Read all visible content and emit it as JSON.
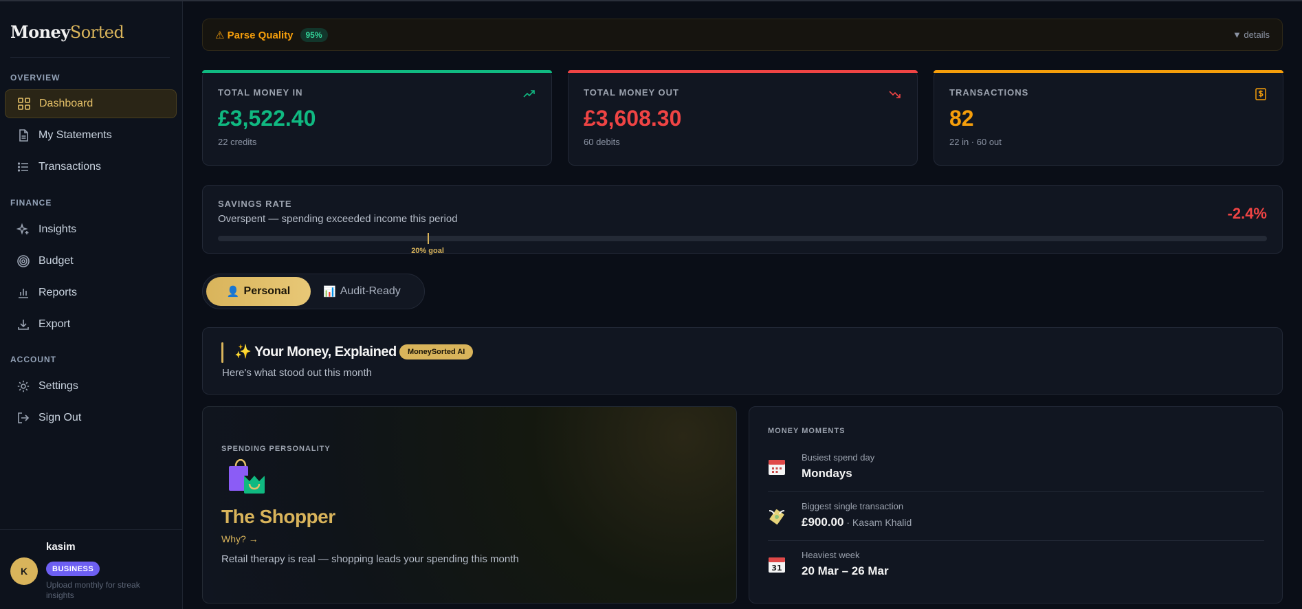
{
  "brand": {
    "part1": "Money",
    "part2": "Sorted"
  },
  "sidebar": {
    "sections": [
      {
        "label": "OVERVIEW"
      },
      {
        "label": "FINANCE"
      },
      {
        "label": "ACCOUNT"
      }
    ],
    "items": [
      {
        "label": "Dashboard",
        "icon": "grid-icon",
        "active": true
      },
      {
        "label": "My Statements",
        "icon": "file-icon"
      },
      {
        "label": "Transactions",
        "icon": "list-icon"
      },
      {
        "label": "Insights",
        "icon": "sparkle-icon"
      },
      {
        "label": "Budget",
        "icon": "target-icon"
      },
      {
        "label": "Reports",
        "icon": "bar-chart-icon"
      },
      {
        "label": "Export",
        "icon": "download-icon"
      },
      {
        "label": "Settings",
        "icon": "gear-icon"
      },
      {
        "label": "Sign Out",
        "icon": "logout-icon"
      }
    ]
  },
  "user": {
    "initial": "K",
    "name": "kasim",
    "plan": "BUSINESS",
    "note": "Upload monthly for streak insights"
  },
  "parse_quality": {
    "label": "⚠ Parse Quality",
    "value": "95%",
    "details": "▼ details"
  },
  "stats": [
    {
      "label": "TOTAL MONEY IN",
      "value": "£3,522.40",
      "sub": "22 credits",
      "color": "#10b981",
      "icon": "trend-up-icon"
    },
    {
      "label": "TOTAL MONEY OUT",
      "value": "£3,608.30",
      "sub": "60 debits",
      "color": "#ef4444",
      "icon": "trend-down-icon"
    },
    {
      "label": "TRANSACTIONS",
      "value": "82",
      "sub": "22 in · 60 out",
      "color": "#f59e0b",
      "icon": "receipt-icon"
    }
  ],
  "savings": {
    "label": "SAVINGS RATE",
    "desc": "Overspent — spending exceeded income this period",
    "rate": "-2.4%",
    "goal_label": "20% goal",
    "goal_fraction": 0.2
  },
  "view_toggle": {
    "personal": "Personal",
    "audit": "Audit-Ready",
    "personal_icon": "👤",
    "audit_icon": "📊",
    "active": "personal"
  },
  "explained": {
    "title": "✨ Your Money, Explained",
    "badge": "MoneySorted AI",
    "subtitle": "Here's what stood out this month"
  },
  "personality": {
    "label": "SPENDING PERSONALITY",
    "name": "The Shopper",
    "why": "Why? →",
    "desc": "Retail therapy is real — shopping leads your spending this month",
    "icon": "shopping-bags-icon"
  },
  "moments": {
    "label": "MONEY MOMENTS",
    "items": [
      {
        "key": "Busiest spend day",
        "value": "Mondays",
        "extra": "",
        "icon": "calendar-icon"
      },
      {
        "key": "Biggest single transaction",
        "value": "£900.00",
        "extra": " · Kasam Khalid",
        "icon": "money-wings-icon"
      },
      {
        "key": "Heaviest week",
        "value": "20 Mar – 26 Mar",
        "extra": "",
        "icon": "calendar-31-icon"
      }
    ]
  }
}
